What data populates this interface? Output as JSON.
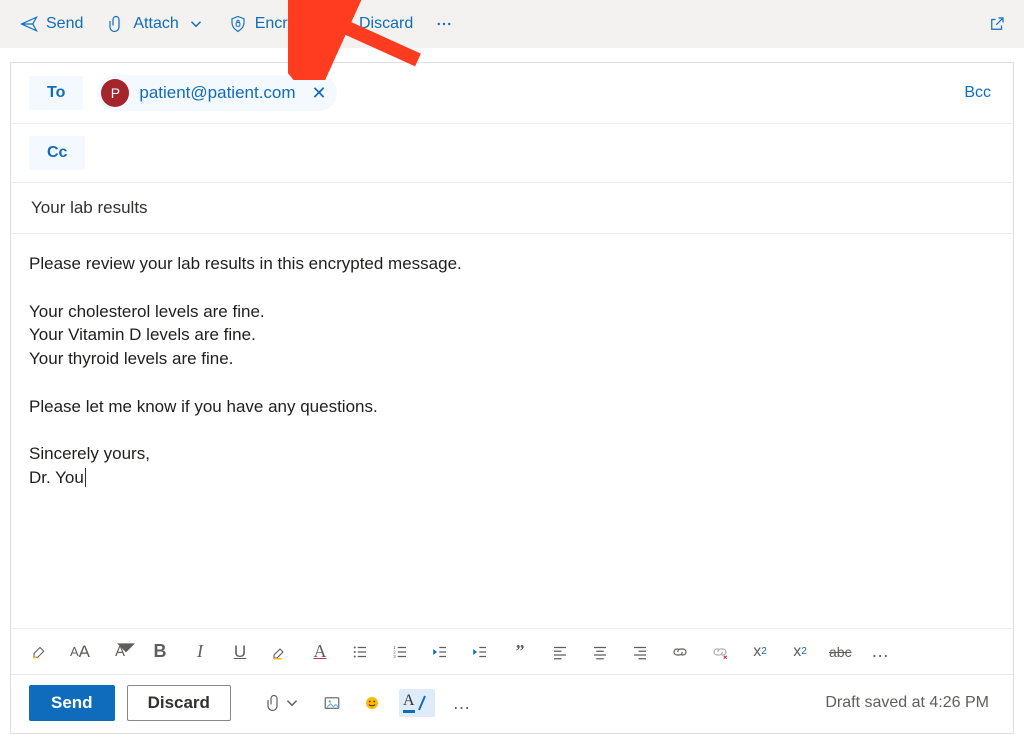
{
  "toolbar": {
    "send": "Send",
    "attach": "Attach",
    "encrypt": "Encrypt",
    "discard": "Discard"
  },
  "recipients": {
    "to_label": "To",
    "cc_label": "Cc",
    "bcc_label": "Bcc",
    "to": [
      {
        "initial": "P",
        "email": "patient@patient.com"
      }
    ]
  },
  "subject": "Your lab results",
  "body_lines": [
    "Please review your lab results in this encrypted message.",
    "",
    "Your cholesterol levels are fine.",
    "Your Vitamin D levels are fine.",
    "Your thyroid levels are fine.",
    "",
    "Please let me know if you have any questions.",
    "",
    "Sincerely yours,",
    "Dr. You"
  ],
  "bottom": {
    "send": "Send",
    "discard": "Discard",
    "draft_status": "Draft saved at 4:26 PM"
  },
  "format": {
    "bold": "B",
    "italic": "I",
    "underline": "U",
    "highlight_letter": "A",
    "color_letter": "A",
    "quote": "”",
    "strike": "abc",
    "more": "…",
    "superscript": "x",
    "subscript": "x",
    "font_case": "A",
    "font_size": "A"
  }
}
